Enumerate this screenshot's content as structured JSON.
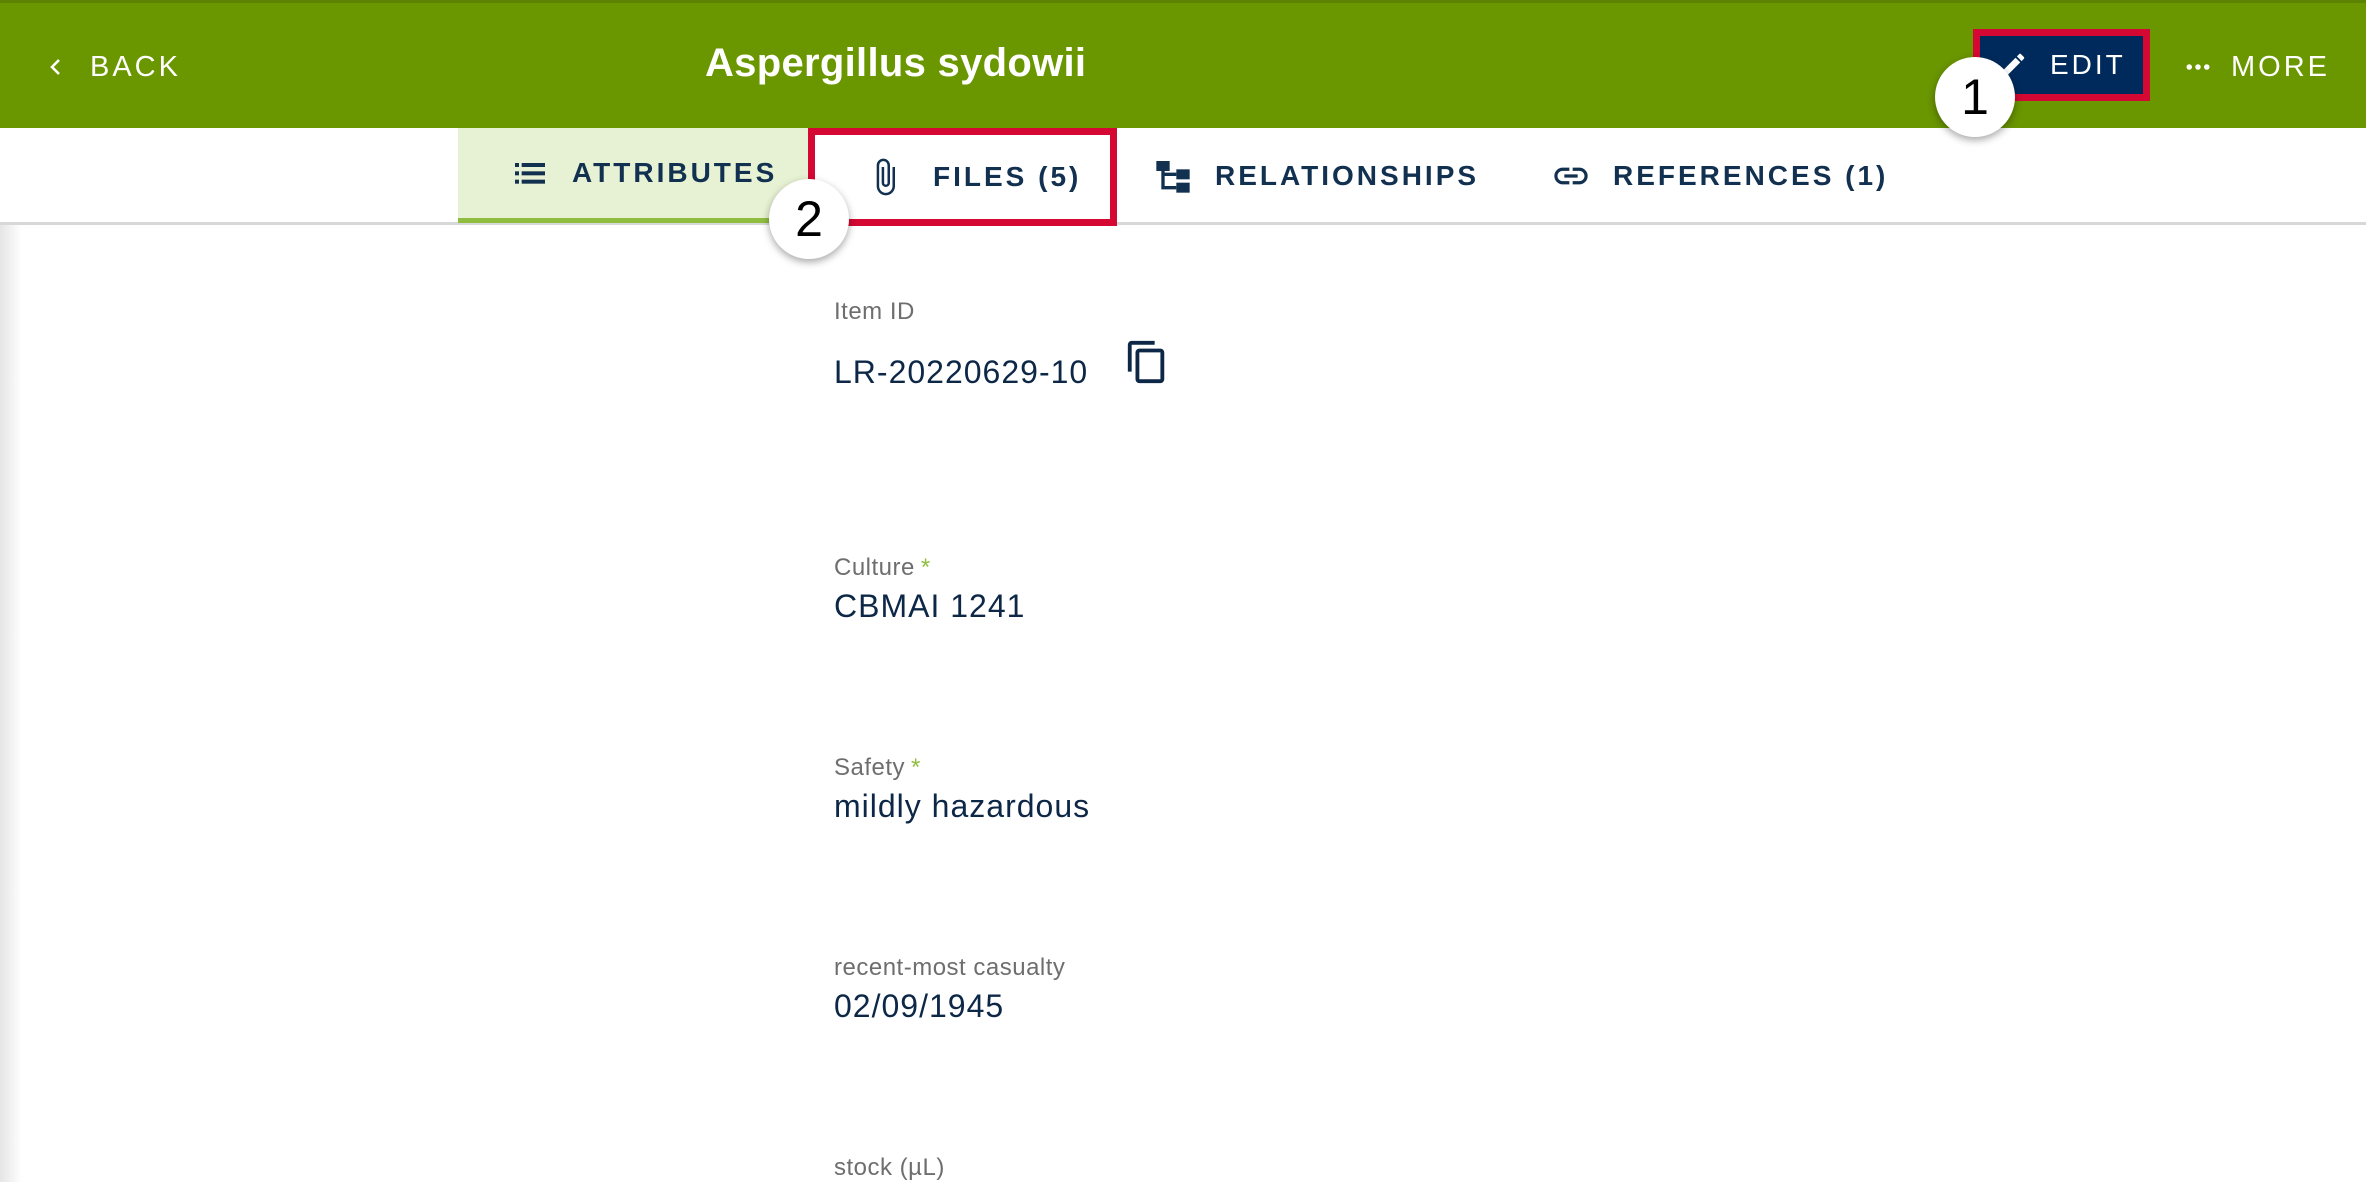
{
  "header": {
    "back_label": "BACK",
    "title": "Aspergillus sydowii",
    "edit_label": "EDIT",
    "more_label": "MORE"
  },
  "tabs": [
    {
      "label": "ATTRIBUTES",
      "icon": "list-icon",
      "selected": true
    },
    {
      "label": "FILES (5)",
      "icon": "paperclip-icon"
    },
    {
      "label": "RELATIONSHIPS",
      "icon": "hierarchy-icon"
    },
    {
      "label": "REFERENCES (1)",
      "icon": "link-icon"
    }
  ],
  "callouts": [
    "1",
    "2"
  ],
  "fields": {
    "item_id": {
      "label": "Item ID",
      "value": "LR-20220629-10"
    },
    "culture": {
      "label": "Culture",
      "required_mark": "*",
      "value": "CBMAI 1241"
    },
    "safety": {
      "label": "Safety",
      "required_mark": "*",
      "value": "mildly hazardous"
    },
    "casualty": {
      "label": "recent-most casualty",
      "value": "02/09/1945"
    },
    "stock": {
      "label": "stock (µL)"
    }
  },
  "colors": {
    "app_bar": "#6a9600",
    "edit_button": "#012a5c",
    "highlight": "#d40833",
    "selected_tab": "#e7f1d3",
    "accent": "#8fbd3f"
  }
}
